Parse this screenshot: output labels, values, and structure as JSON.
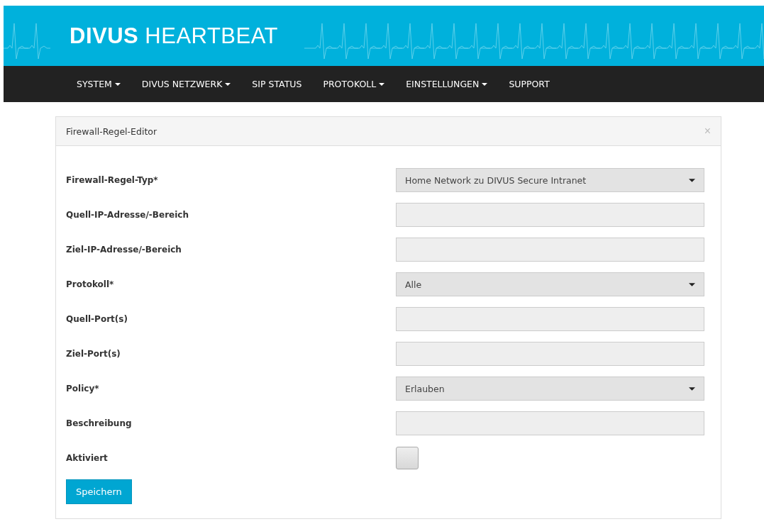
{
  "header": {
    "logo": "**DIVUS** HEARTBEAT"
  },
  "nav": [
    {
      "label": "SYSTEM",
      "dropdown": true
    },
    {
      "label": "DIVUS NETZWERK",
      "dropdown": true
    },
    {
      "label": "SIP STATUS",
      "dropdown": false
    },
    {
      "label": "PROTOKOLL",
      "dropdown": true
    },
    {
      "label": "EINSTELLUNGEN",
      "dropdown": true
    },
    {
      "label": "SUPPORT",
      "dropdown": false
    }
  ],
  "panel": {
    "title": "Firewall-Regel-Editor",
    "close": "×",
    "fields": [
      {
        "label": "Firewall-Regel-Typ*",
        "kind": "select",
        "value": "Home Network zu DIVUS Secure Intranet"
      },
      {
        "label": "Quell-IP-Adresse/-Bereich",
        "kind": "text"
      },
      {
        "label": "Ziel-IP-Adresse/-Bereich",
        "kind": "text"
      },
      {
        "label": "Protokoll*",
        "kind": "select",
        "value": "Alle"
      },
      {
        "label": "Quell-Port(s)",
        "kind": "text"
      },
      {
        "label": "Ziel-Port(s)",
        "kind": "text"
      },
      {
        "label": "Policy*",
        "kind": "select",
        "value": "Erlauben"
      },
      {
        "label": "Beschreibung",
        "kind": "text"
      },
      {
        "label": "Aktiviert",
        "kind": "checkbox",
        "checked": false
      }
    ],
    "save_button": "Speichern"
  }
}
